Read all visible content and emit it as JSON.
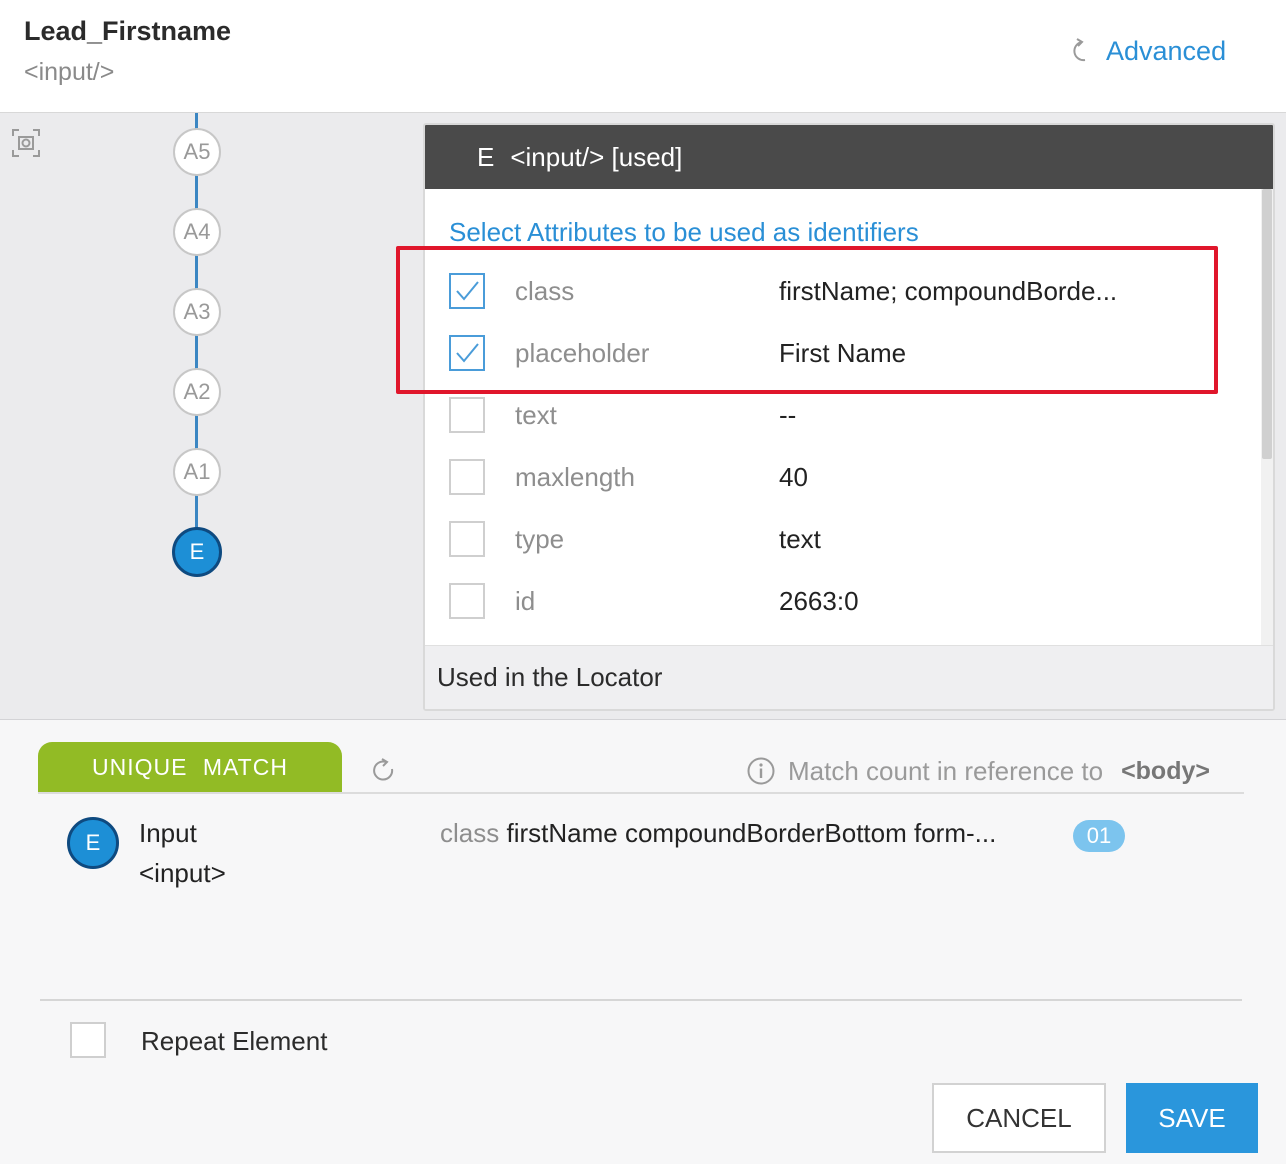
{
  "header": {
    "title": "Lead_Firstname",
    "subtitle": "<input/>",
    "advanced_label": "Advanced",
    "advanced_icon": "reset-arrow-icon"
  },
  "tree": {
    "nodes": [
      "A5",
      "A4",
      "A3",
      "A2",
      "A1",
      "E"
    ],
    "active": "E",
    "line_color": "#3b86c2"
  },
  "panel": {
    "header_letter": "E",
    "header_text": "<input/> [used]",
    "select_label": "Select Attributes to be used as identifiers",
    "attributes": [
      {
        "name": "class",
        "value": "firstName; compoundBorde...",
        "checked": true
      },
      {
        "name": "placeholder",
        "value": "First Name",
        "checked": true
      },
      {
        "name": "text",
        "value": "--",
        "checked": false
      },
      {
        "name": "maxlength",
        "value": "40",
        "checked": false
      },
      {
        "name": "type",
        "value": "text",
        "checked": false
      },
      {
        "name": "id",
        "value": "2663:0",
        "checked": false
      }
    ],
    "footer_label": "Used in the Locator",
    "highlight_color": "#e0162b"
  },
  "match": {
    "tab_label": "UNIQUE  MATCH",
    "tab_color": "#92bb25",
    "reference_label": "Match count in reference to",
    "reference_tag": "<body>",
    "result": {
      "node": "E",
      "name": "Input",
      "tag": "<input>",
      "attr_key": "class",
      "attr_value": "firstName compoundBorderBottom form-...",
      "count": "01"
    }
  },
  "repeat": {
    "label": "Repeat Element",
    "checked": false
  },
  "buttons": {
    "cancel": "CANCEL",
    "save": "SAVE",
    "save_color": "#2a96dc"
  }
}
